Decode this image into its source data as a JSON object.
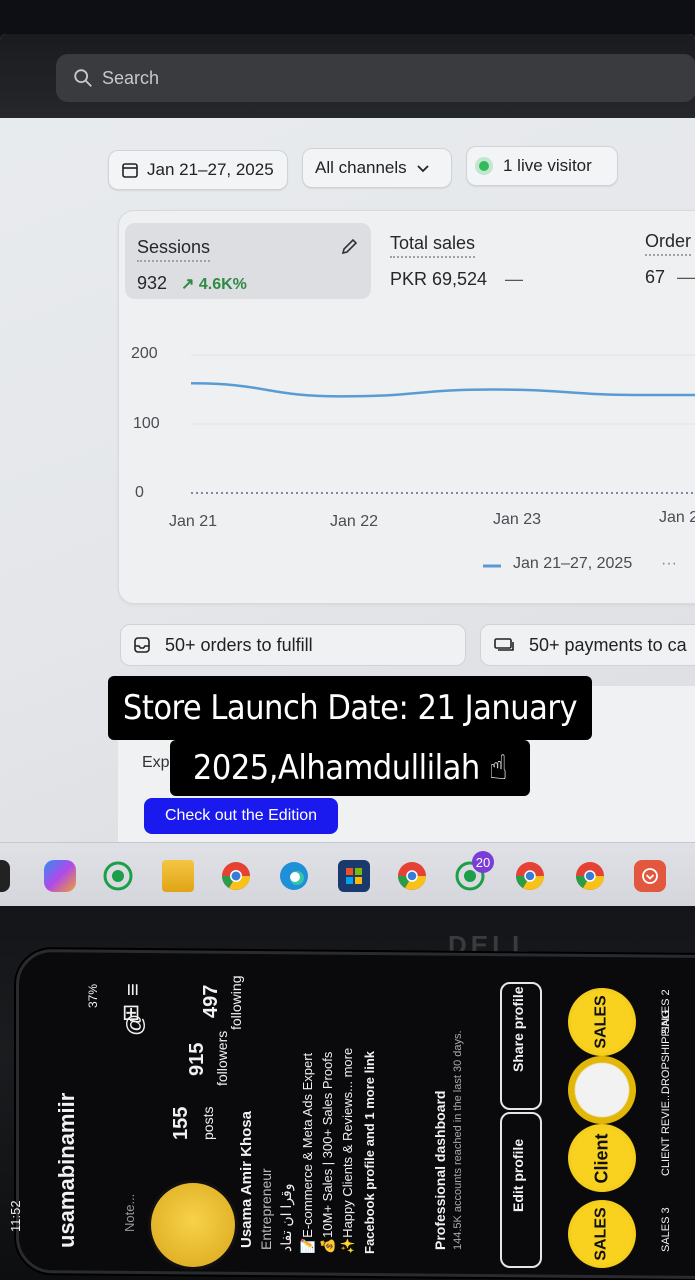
{
  "search": {
    "placeholder": "Search"
  },
  "filters": {
    "date_range": "Jan 21–27, 2025",
    "channels": "All channels",
    "live": "1 live visitor"
  },
  "metrics": {
    "sessions": {
      "label": "Sessions",
      "value": "932",
      "change": "4.6K%"
    },
    "total_sales": {
      "label": "Total sales",
      "value": "PKR 69,524",
      "trend": "—"
    },
    "orders": {
      "label": "Order",
      "value": "67",
      "trend": "—"
    }
  },
  "chart_data": {
    "type": "line",
    "ylim": [
      0,
      200
    ],
    "y_ticks": [
      "200",
      "100",
      "0"
    ],
    "x_ticks": [
      "Jan 21",
      "Jan 22",
      "Jan 23",
      "Jan 2"
    ],
    "series": [
      {
        "name": "Jan 21–27, 2025",
        "values": [
          159,
          140,
          150,
          142
        ]
      },
      {
        "values": [
          0,
          0,
          0,
          0
        ]
      }
    ],
    "legend_more": "···"
  },
  "tasks": {
    "fulfill": "50+ orders to fulfill",
    "payments": "50+ payments to ca"
  },
  "promo": {
    "text": "Exp",
    "cta": "Check out the Edition"
  },
  "caption": {
    "line1": "Store Launch Date: 21 January",
    "line2": "2025,Alhamdullilah ☝"
  },
  "taskbar": {
    "badge": "20"
  },
  "monitor_brand": "DELL",
  "phone": {
    "time": "11:52",
    "battery": "37%",
    "username": "usamabinamiir",
    "note": "Note...",
    "posts": "155",
    "posts_label": "posts",
    "followers": "915",
    "followers_label": "followers",
    "following": "497",
    "following_label": "following",
    "name": "Usama Amir Khosa",
    "role": "Entrepreneur",
    "bio_ar": "وقرا ان تفاد",
    "bio1": "📝E-commerce & Meta Ads Expert",
    "bio2": "💰10M+ Sales | 300+ Sales Proofs",
    "bio3": "✨Happy Clients & Reviews... more",
    "link": "Facebook profile and 1 more link",
    "dashboard": "Professional dashboard",
    "dashboard_sub": "144.5K accounts reached in the last 30 days.",
    "edit": "Edit profile",
    "share": "Share profile",
    "highlights": [
      "SALES 3",
      "CLIENT REVIE...",
      "DROPSHIPPING",
      "SALES 2"
    ],
    "hl_text": [
      "SALES",
      "Client",
      "SALES"
    ]
  },
  "colors": {
    "accent": "#1a1aef",
    "chart_line": "#5b9bd5",
    "live_dot": "#2ebd59",
    "highlight": "#f9d21f"
  }
}
